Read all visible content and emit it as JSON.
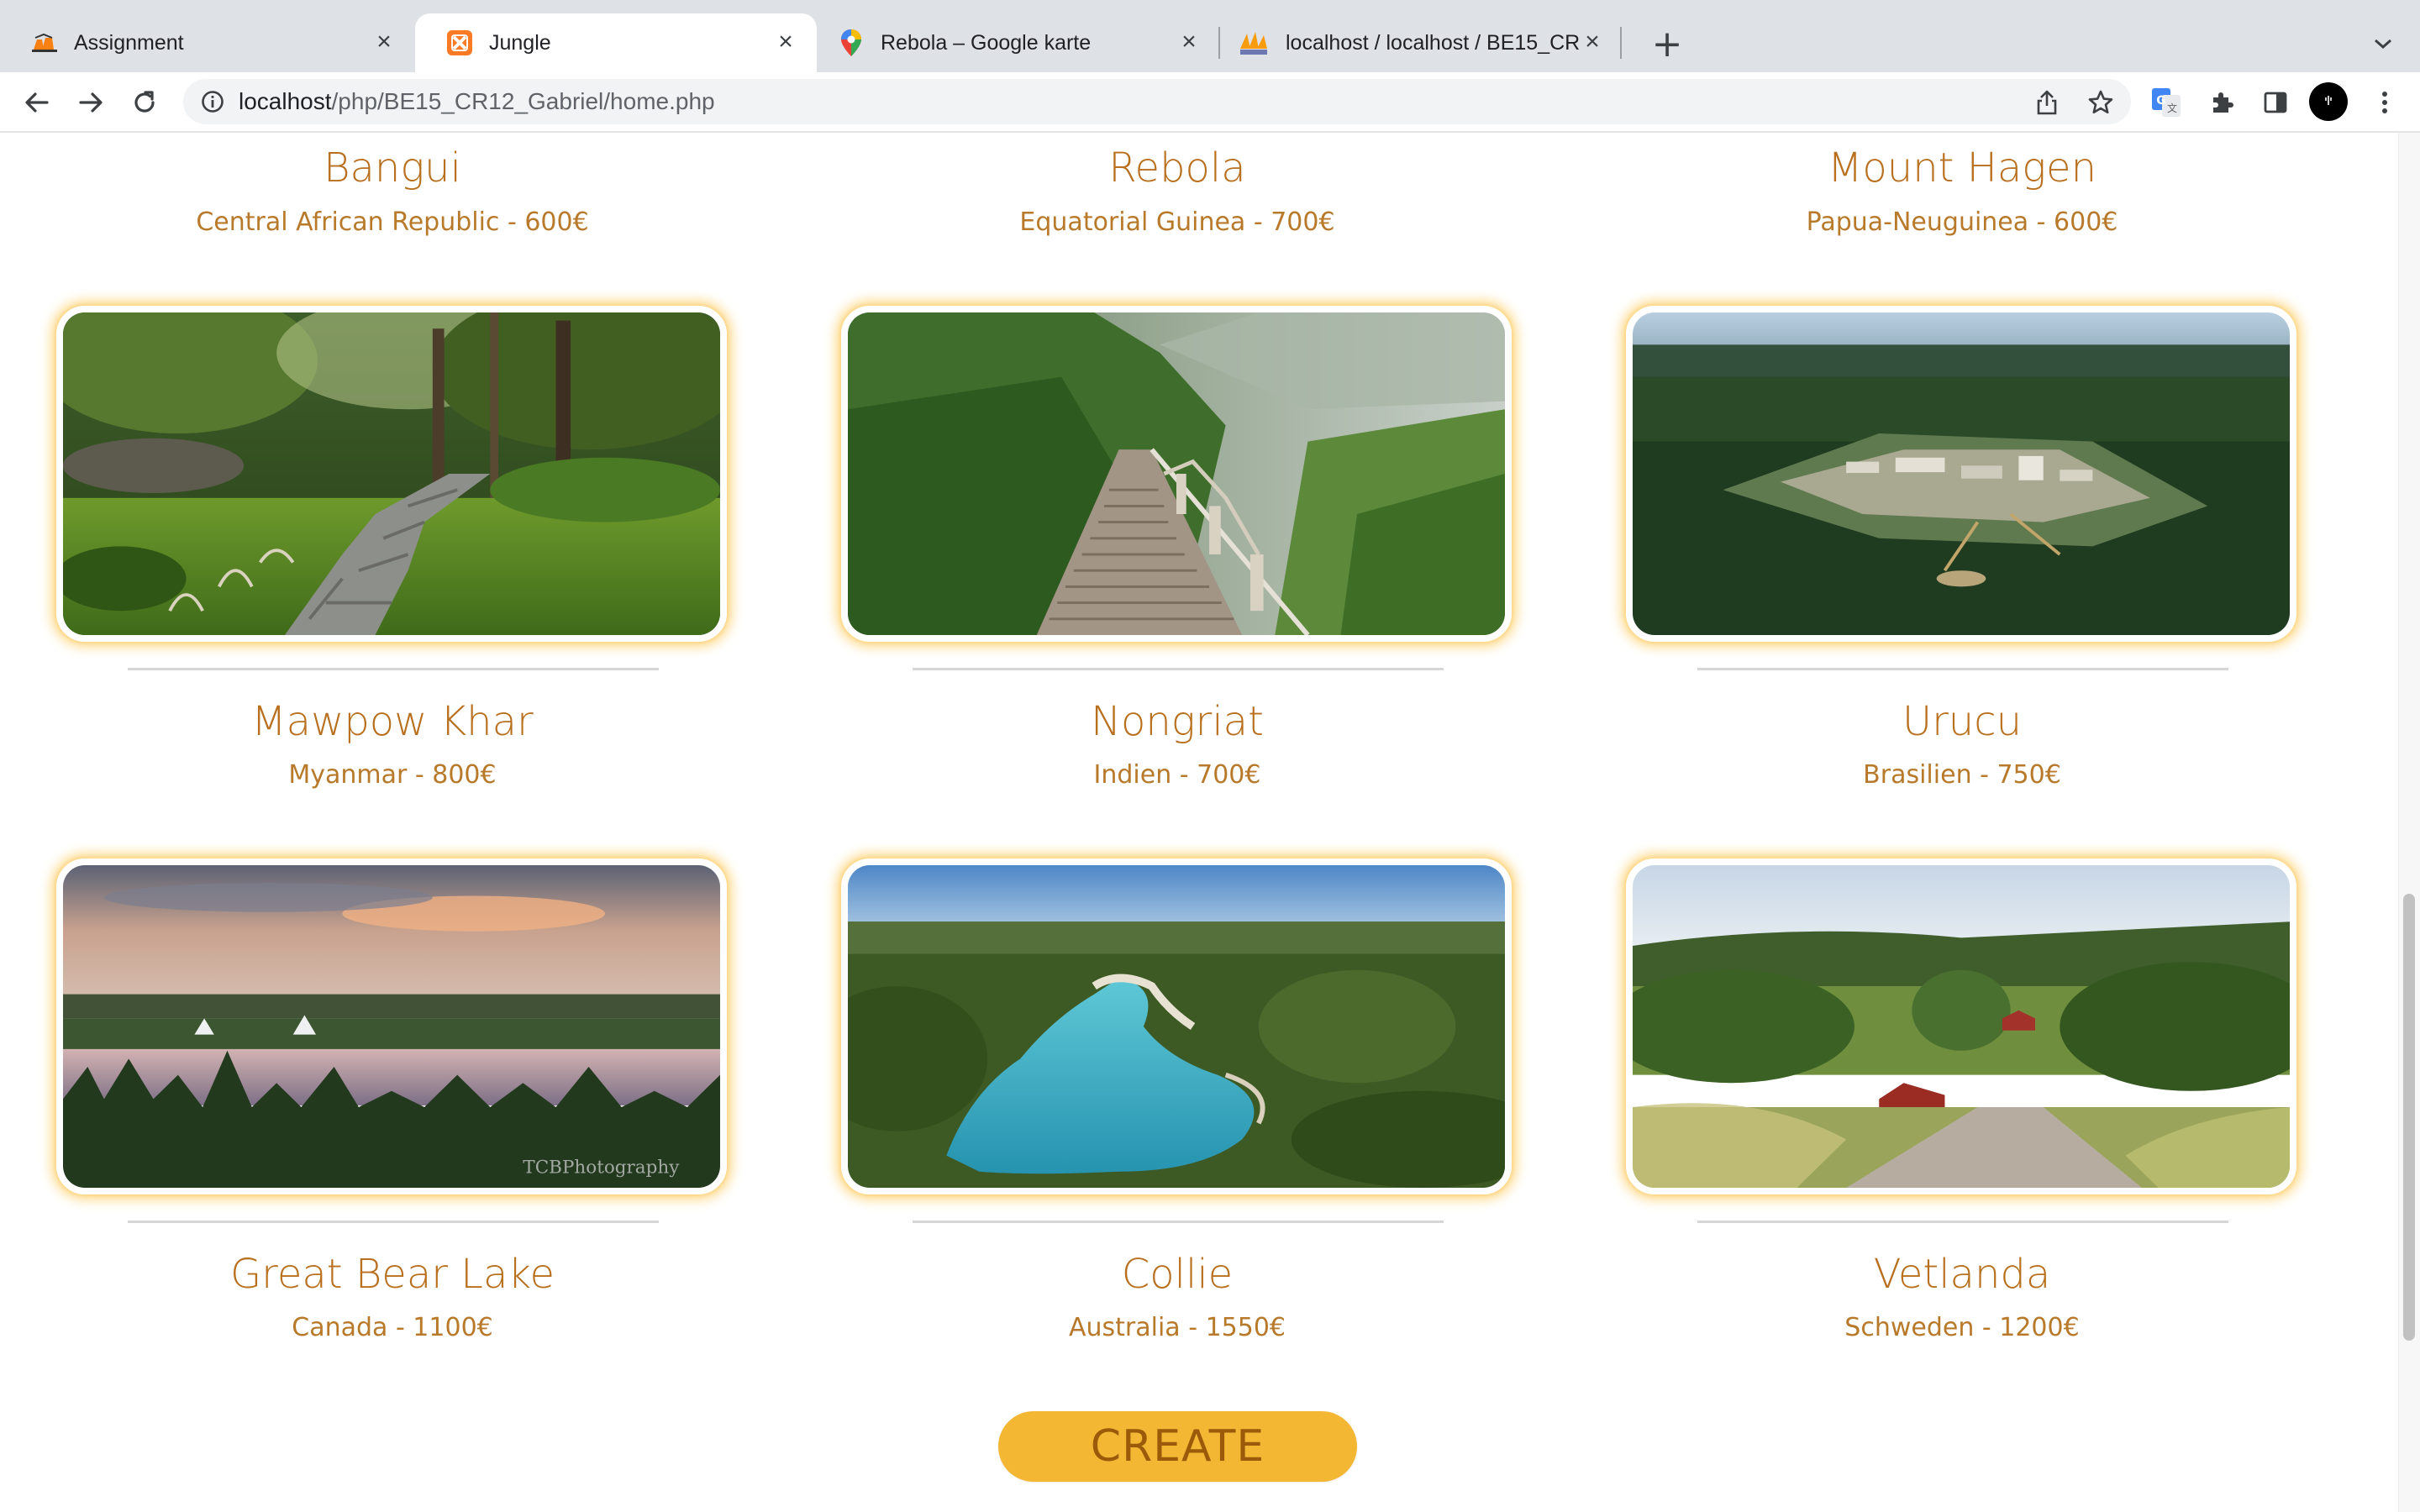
{
  "browser": {
    "tabs": [
      {
        "title": "Assignment",
        "icon": "moodle-icon"
      },
      {
        "title": "Jungle",
        "icon": "xampp-icon"
      },
      {
        "title": "Rebola – Google karte",
        "icon": "maps-pin-icon"
      },
      {
        "title": "localhost / localhost / BE15_CR",
        "icon": "phpmyadmin-icon"
      }
    ],
    "active_tab": 1,
    "url_host": "localhost",
    "url_path": "/php/BE15_CR12_Gabriel/home.php"
  },
  "destinations": [
    {
      "city": "Bangui",
      "info": "Central African Republic - 600€"
    },
    {
      "city": "Rebola",
      "info": "Equatorial Guinea - 700€"
    },
    {
      "city": "Mount Hagen",
      "info": "Papua-Neuguinea - 600€"
    },
    {
      "city": "Mawpow Khar",
      "info": "Myanmar - 800€",
      "image": "japanese-garden-path"
    },
    {
      "city": "Nongriat",
      "info": "Indien - 700€",
      "image": "jungle-stairway"
    },
    {
      "city": "Urucu",
      "info": "Brasilien - 750€",
      "image": "rainforest-oil-base"
    },
    {
      "city": "Great Bear Lake",
      "info": "Canada - 1100€",
      "image": "lake-with-tipis",
      "image_text": "TCBPhotography"
    },
    {
      "city": "Collie",
      "info": "Australia - 1550€",
      "image": "turquoise-lake"
    },
    {
      "city": "Vetlanda",
      "info": "Schweden - 1200€",
      "image": "swedish-countryside"
    }
  ],
  "create_button": "CREATE",
  "colors": {
    "accent_button": "#f3b733",
    "title_text": "#b86f1e",
    "card_glow": "#ffd98a"
  }
}
